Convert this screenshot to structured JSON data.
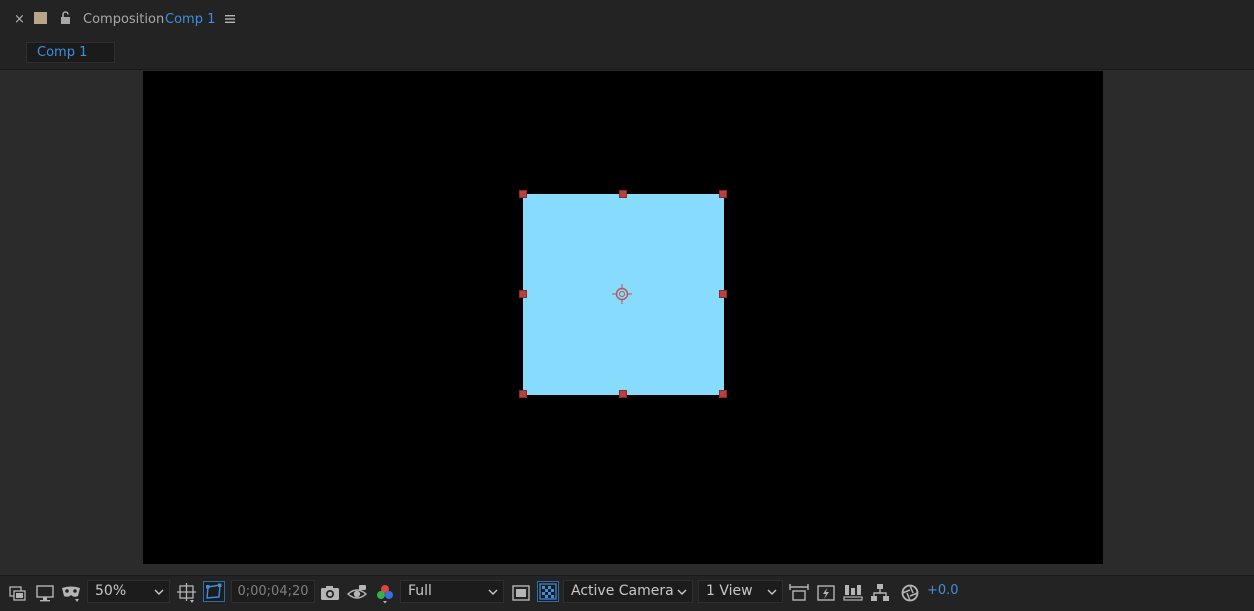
{
  "panel": {
    "close_label": "×",
    "title_prefix": "Composition",
    "title_name": "Comp 1",
    "tab_label": "Comp 1"
  },
  "composition": {
    "background_color": "#000000",
    "layer": {
      "type": "solid",
      "color": "#87dbfd",
      "handle_color": "#b8403f"
    }
  },
  "toolbar": {
    "magnification": "50%",
    "timecode": "0;00;04;20",
    "resolution": "Full",
    "camera": "Active Camera",
    "views": "1 View",
    "exposure": "+0.0",
    "icons": [
      "always-preview-icon",
      "monitor-icon",
      "mask-visibility-icon",
      "choose-grid-icon",
      "toggle-mask-path-icon",
      "snapshot-icon",
      "show-snapshot-icon",
      "show-channel-icon",
      "region-of-interest-icon",
      "transparency-grid-icon",
      "3d-renderer-icon",
      "fast-previews-icon",
      "timeline-icon",
      "flowchart-icon",
      "reset-exposure-icon"
    ]
  }
}
